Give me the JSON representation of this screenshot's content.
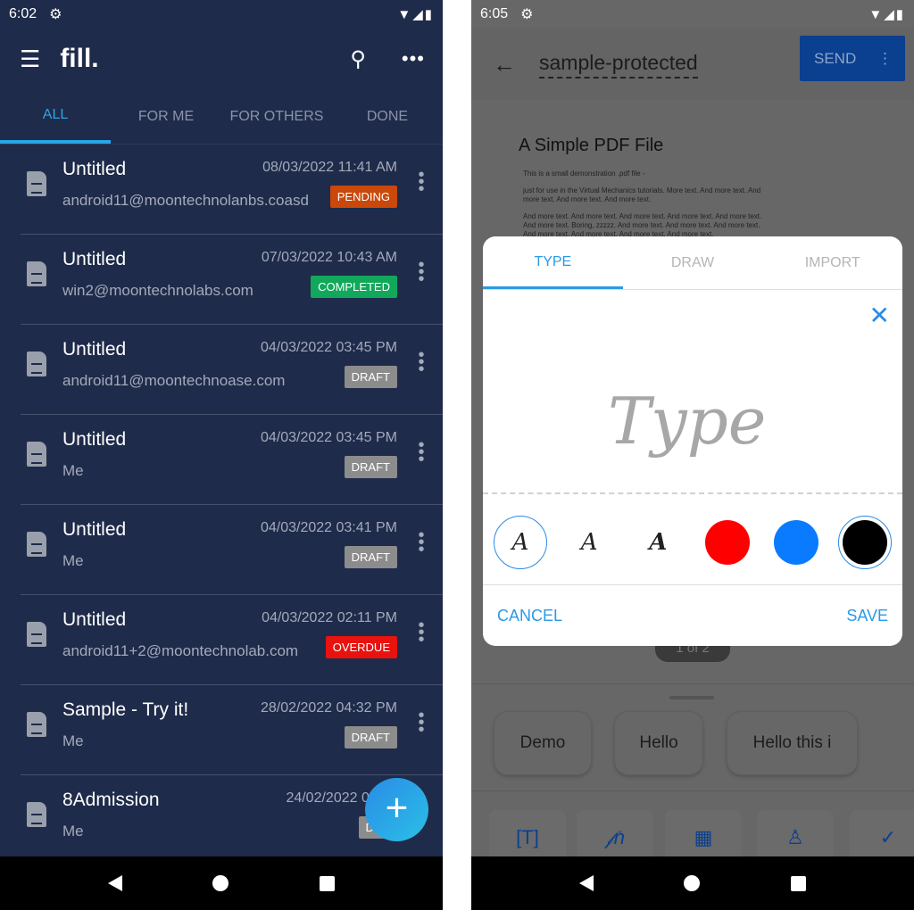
{
  "left": {
    "status": {
      "time": "6:02"
    },
    "app": {
      "logo": "fill."
    },
    "tabs": [
      "ALL",
      "FOR ME",
      "FOR OTHERS",
      "DONE"
    ],
    "items": [
      {
        "title": "Untitled",
        "date": "08/03/2022 11:41 AM",
        "sub": "android11@moontechnolanbs.coasd",
        "status": "PENDING",
        "color": "#c9480a"
      },
      {
        "title": "Untitled",
        "date": "07/03/2022 10:43 AM",
        "sub": "win2@moontechnolabs.com",
        "status": "COMPLETED",
        "color": "#12a85c"
      },
      {
        "title": "Untitled",
        "date": "04/03/2022 03:45 PM",
        "sub": "android11@moontechnoase.com",
        "status": "DRAFT",
        "color": "#8c8c8c"
      },
      {
        "title": "Untitled",
        "date": "04/03/2022 03:45 PM",
        "sub": "Me",
        "status": "DRAFT",
        "color": "#8c8c8c"
      },
      {
        "title": "Untitled",
        "date": "04/03/2022 03:41 PM",
        "sub": "Me",
        "status": "DRAFT",
        "color": "#8c8c8c"
      },
      {
        "title": "Untitled",
        "date": "04/03/2022 02:11 PM",
        "sub": "android11+2@moontechnolab.com",
        "status": "OVERDUE",
        "color": "#e8120f"
      },
      {
        "title": "Sample - Try it!",
        "date": "28/02/2022 04:32 PM",
        "sub": "Me",
        "status": "DRAFT",
        "color": "#8c8c8c"
      },
      {
        "title": "8Admission",
        "date": "24/02/2022 01:49",
        "sub": "Me",
        "status": "DRA",
        "color": "#8c8c8c"
      }
    ],
    "fab": "+"
  },
  "right": {
    "status": {
      "time": "6:05"
    },
    "doc_title": "sample-protected",
    "send": "SEND",
    "pdf": {
      "heading": "A Simple PDF File",
      "paras": [
        "This is a small demonstration .pdf file -",
        "just for use in the Virtual Mechanics tutorials. More text. And more text. And more text. And more text. And more text.",
        "And more text. And more text. And more text. And more text. And more text. And more text. Boring, zzzzz. And more text. And more text. And more text. And more text. And more text. And more text. And more text."
      ]
    },
    "pager": "1 of 2",
    "dialog": {
      "tabs": [
        "TYPE",
        "DRAW",
        "IMPORT"
      ],
      "signature": "Type",
      "cancel": "CANCEL",
      "save": "SAVE",
      "colors": [
        "#ff0000",
        "#0a7bff",
        "#000000"
      ],
      "font_samples": [
        "A",
        "A",
        "A"
      ]
    },
    "chips": [
      "Demo",
      "Hello",
      "Hello this i"
    ],
    "tools": [
      "text-field-icon",
      "signature-icon",
      "calendar-icon",
      "stamp-icon",
      "checkbox-icon"
    ]
  }
}
